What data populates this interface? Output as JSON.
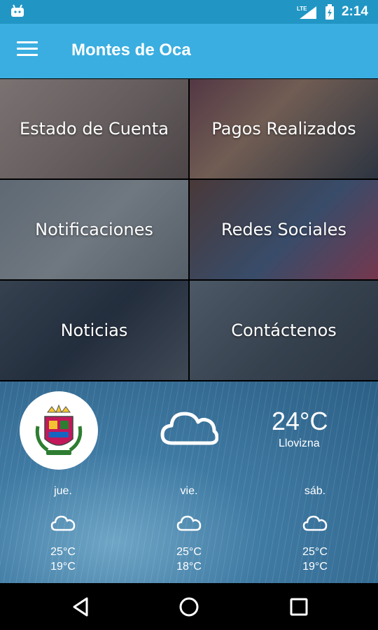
{
  "status_bar": {
    "network_label": "LTE",
    "time": "2:14"
  },
  "app_bar": {
    "title": "Montes de Oca"
  },
  "tiles": [
    {
      "label": "Estado de Cuenta"
    },
    {
      "label": "Pagos Realizados"
    },
    {
      "label": "Notificaciones"
    },
    {
      "label": "Redes Sociales"
    },
    {
      "label": "Noticias"
    },
    {
      "label": "Contáctenos"
    }
  ],
  "weather": {
    "current_temp": "24°C",
    "current_desc": "Llovizna",
    "current_icon": "cloud-icon",
    "forecast": [
      {
        "day": "jue.",
        "high": "25°C",
        "low": "19°C",
        "icon": "cloud-icon"
      },
      {
        "day": "vie.",
        "high": "25°C",
        "low": "18°C",
        "icon": "cloud-icon"
      },
      {
        "day": "sáb.",
        "high": "25°C",
        "low": "19°C",
        "icon": "cloud-icon"
      }
    ]
  },
  "colors": {
    "status_bar": "#2196c4",
    "app_bar": "#3aaee0",
    "nav_bar": "#000000"
  }
}
